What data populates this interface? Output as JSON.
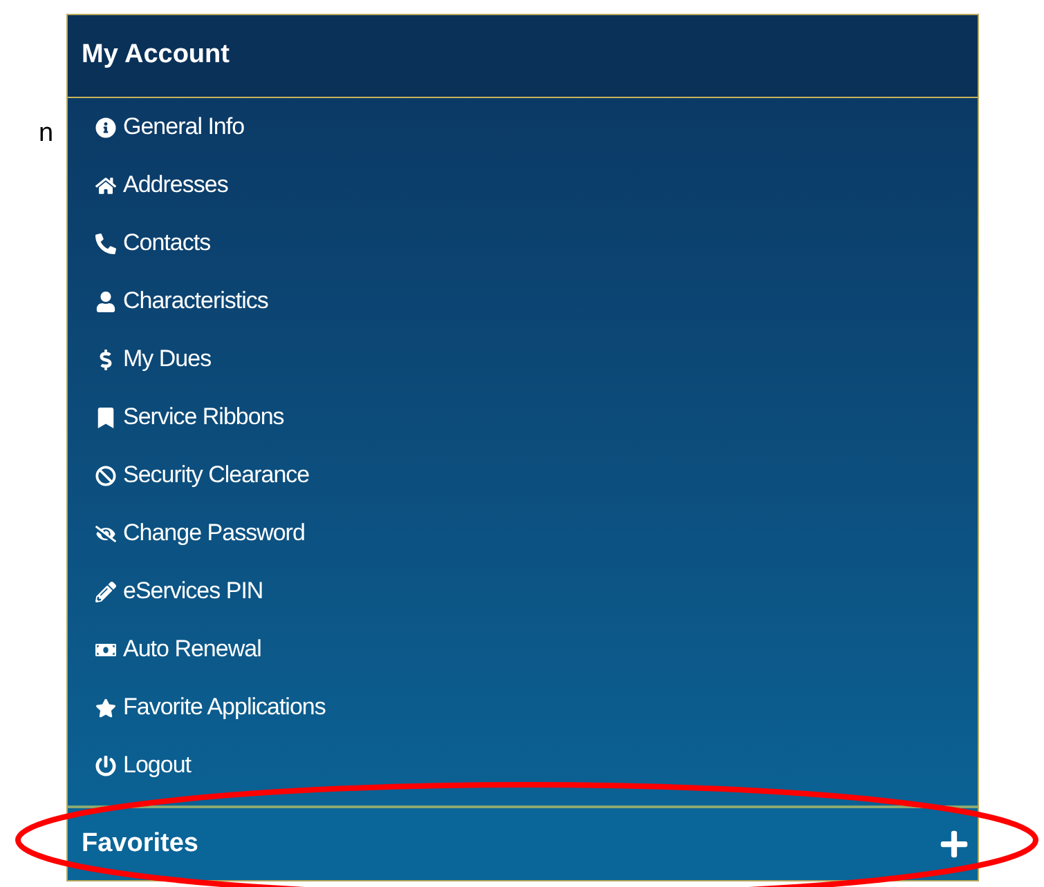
{
  "side_text": "n",
  "panel": {
    "title": "My Account",
    "items": [
      {
        "label": "General Info"
      },
      {
        "label": "Addresses"
      },
      {
        "label": "Contacts"
      },
      {
        "label": "Characteristics"
      },
      {
        "label": "My Dues"
      },
      {
        "label": "Service Ribbons"
      },
      {
        "label": "Security Clearance"
      },
      {
        "label": "Change Password"
      },
      {
        "label": "eServices PIN"
      },
      {
        "label": "Auto Renewal"
      },
      {
        "label": "Favorite Applications"
      },
      {
        "label": "Logout"
      }
    ]
  },
  "favorites": {
    "title": "Favorites"
  }
}
